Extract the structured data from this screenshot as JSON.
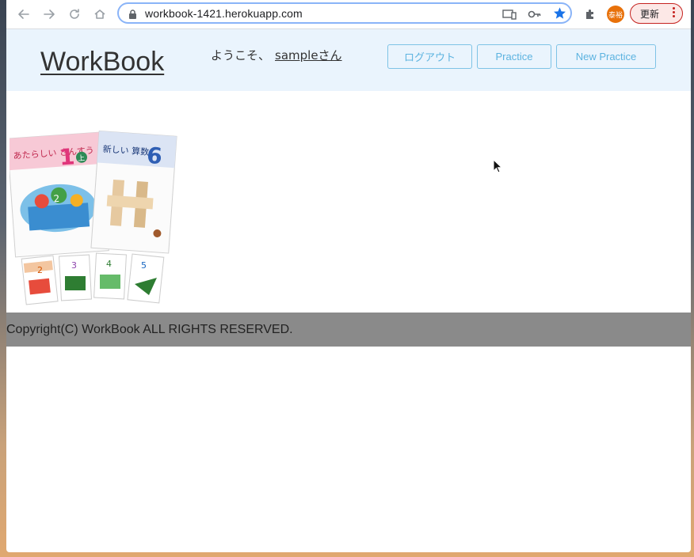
{
  "browser": {
    "url": "workbook-1421.herokuapp.com",
    "profile_initials": "泰裕",
    "update_label": "更新"
  },
  "header": {
    "logo": "WorkBook",
    "welcome_prefix": "ようこそ、",
    "user_name": "sampleさん",
    "nav": {
      "logout": "ログアウト",
      "practice": "Practice",
      "new_practice": "New Practice"
    }
  },
  "main": {
    "hero_image": {
      "cover_large_1_title": "あたらしい さんすう",
      "cover_large_1_number": "1",
      "cover_large_1_badge": "上",
      "cover_large_2_title": "新しい 算数",
      "cover_large_2_number": "6",
      "small_cover_numbers": [
        "2",
        "3",
        "4",
        "5"
      ]
    }
  },
  "footer": {
    "copyright": "Copyright(C) WorkBook ALL RIGHTS RESERVED."
  },
  "colors": {
    "header_bg": "#eaf4fd",
    "nav_accent": "#5cb3e0",
    "footer_bg": "#8a8a8a"
  }
}
